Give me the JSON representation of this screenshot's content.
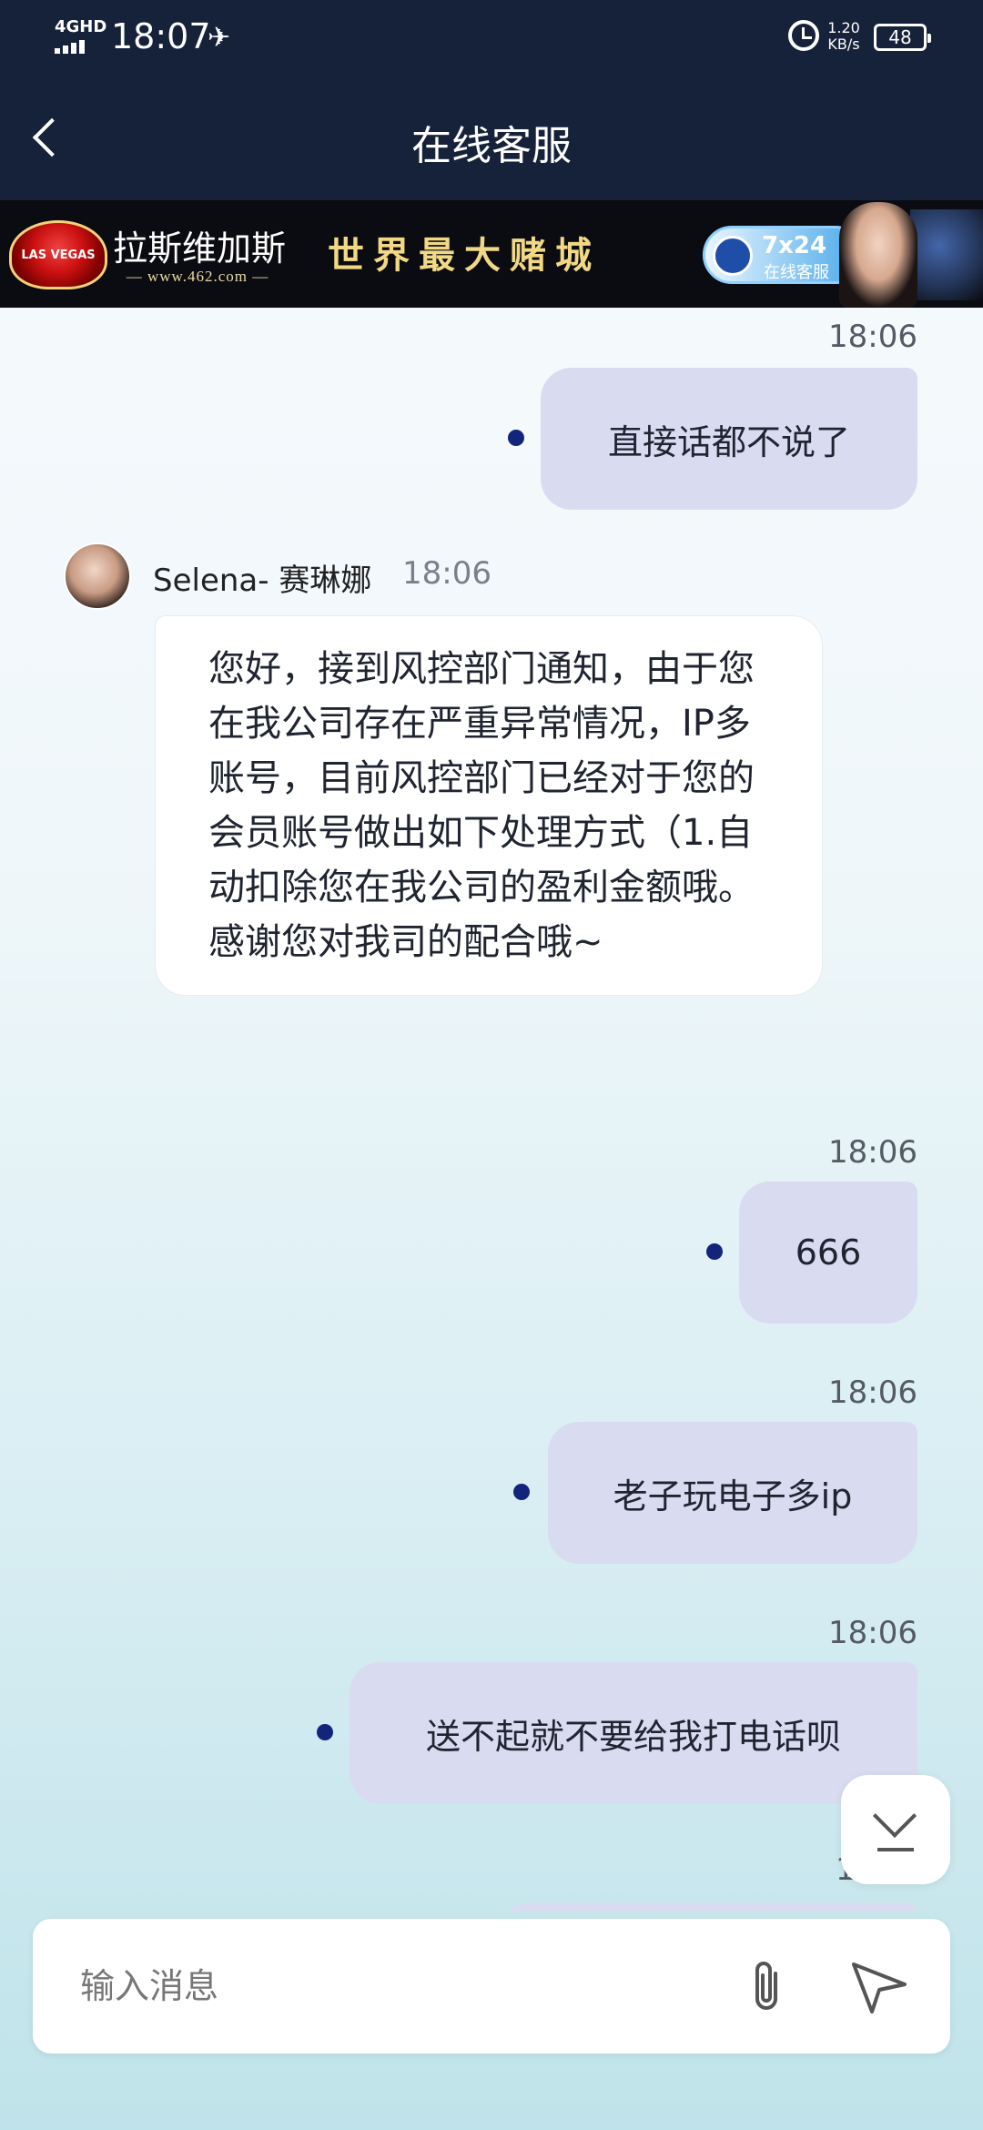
{
  "status_bar": {
    "network": "4GHD",
    "time": "18:07",
    "speed_value": "1.20",
    "speed_unit": "KB/s",
    "battery": "48"
  },
  "header": {
    "title": "在线客服"
  },
  "banner": {
    "logo_text": "LAS VEGAS",
    "name_cn": "拉斯维加斯",
    "url": "— www.462.com —",
    "slogan": "世界最大赌城",
    "badge_top": "7x24",
    "badge_bottom": "在线客服"
  },
  "messages": {
    "m1": {
      "time": "18:06",
      "text": "直接话都不说了"
    },
    "agent": {
      "name": "Selena- 赛琳娜",
      "time": "18:06",
      "text": "您好，接到风控部门通知，由于您在我公司存在严重异常情况，IP多账号，目前风控部门已经对于您的会员账号做出如下处理方式（1.自动扣除您在我公司的盈利金额哦。感谢您对我司的配合哦~"
    },
    "m3": {
      "time": "18:06",
      "text": "666"
    },
    "m4": {
      "time": "18:06",
      "text": "老子玩电子多ip"
    },
    "m5": {
      "time": "18:06",
      "text": "送不起就不要给我打电话呗"
    },
    "m6_partial_time": "1"
  },
  "composer": {
    "placeholder": "输入消息"
  },
  "colors": {
    "header_bg": "#16213a",
    "outgoing_bubble": "#d9dcf1",
    "incoming_bubble": "#ffffff",
    "sent_dot": "#13257a"
  }
}
